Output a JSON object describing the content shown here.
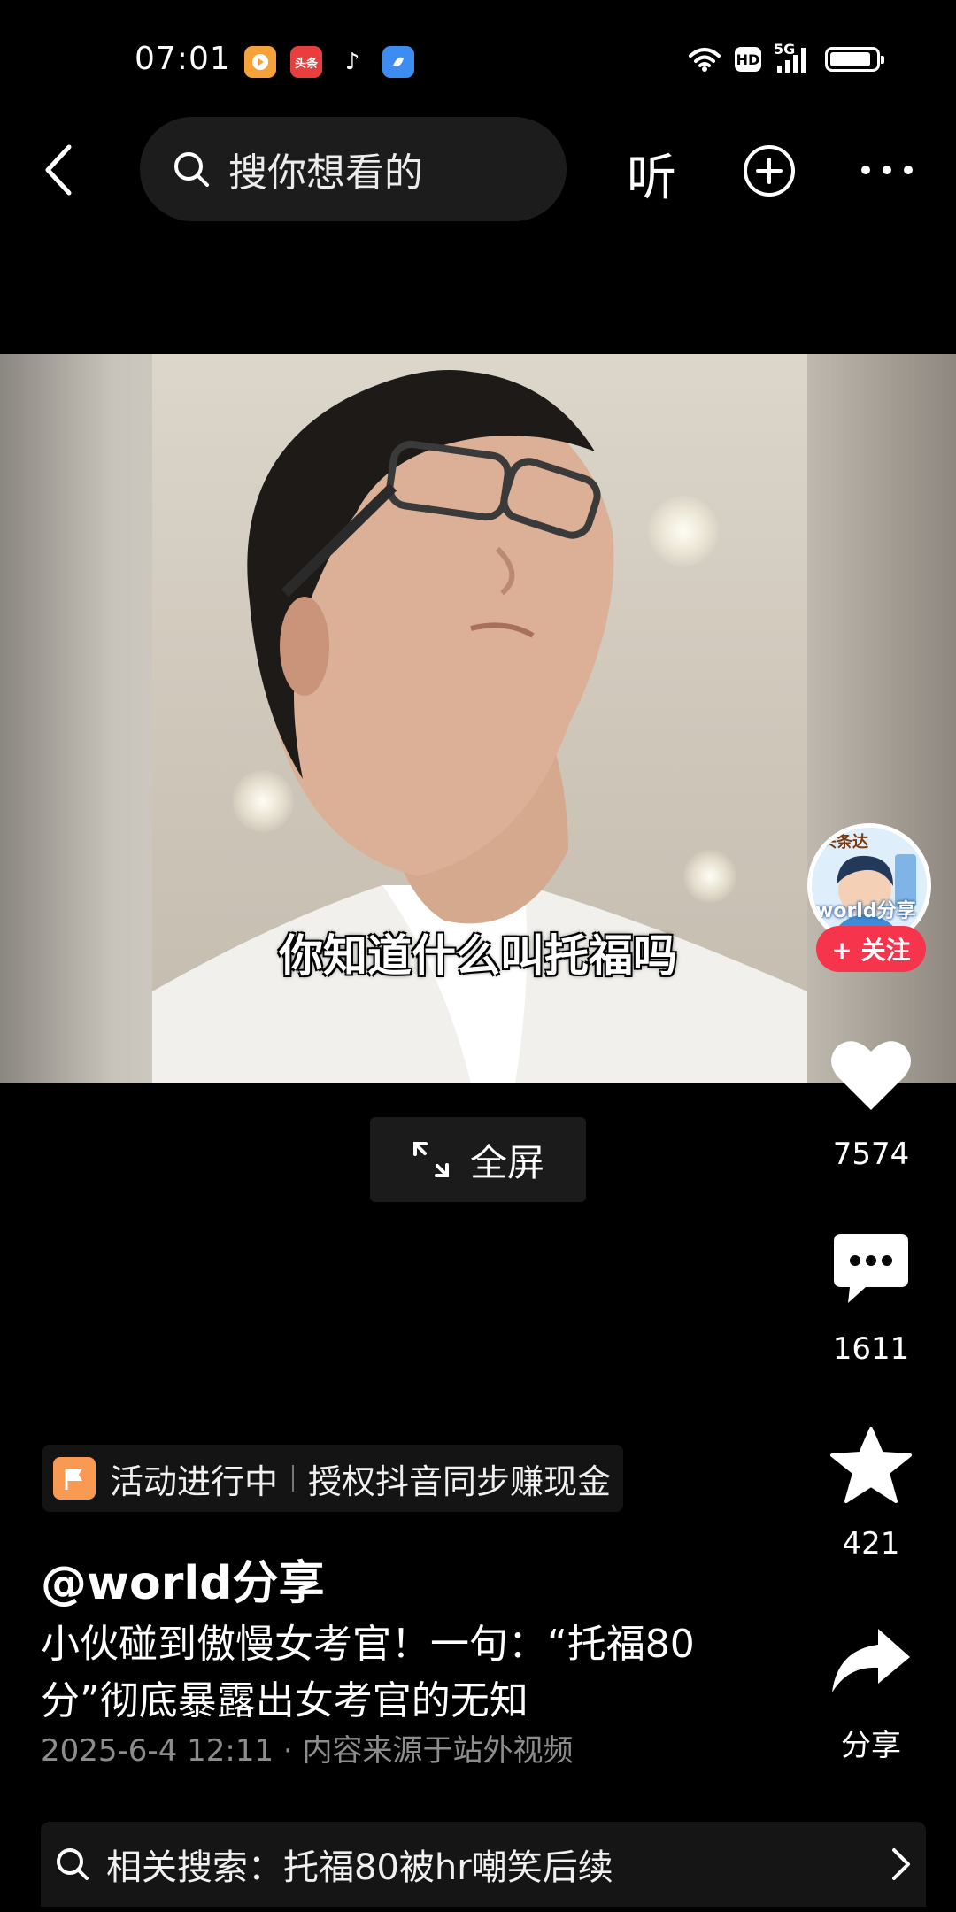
{
  "status_bar": {
    "time": "07:01",
    "app_icons": [
      {
        "name": "video-app-icon",
        "label": "",
        "color": "#f7a13a"
      },
      {
        "name": "toutiao-app-icon",
        "label": "头条",
        "color": "#e83e3e"
      },
      {
        "name": "douyin-app-icon",
        "label": "♪",
        "color": "#000000"
      },
      {
        "name": "blue-app-icon",
        "label": "",
        "color": "#3d8cf0"
      }
    ],
    "hd": "HD",
    "network": "5G",
    "battery_level": 0.9
  },
  "nav": {
    "search_placeholder": "搜你想看的",
    "listen_label": "听"
  },
  "video": {
    "subtitle": "你知道什么叫托福吗",
    "fullscreen_label": "全屏"
  },
  "rail": {
    "avatar_text_top": "头条达",
    "avatar_text": "world分享",
    "follow_label": "+ 关注",
    "like_count": "7574",
    "comment_count": "1611",
    "favorite_count": "421",
    "share_label": "分享"
  },
  "info": {
    "activity_status": "活动进行中",
    "activity_text": "授权抖音同步赚现金",
    "author": "@world分享",
    "description_line1": "小伙碰到傲慢女考官！一句：“托福80",
    "description_line2": "分”彻底暴露出女考官的无知",
    "meta": "2025-6-4 12:11 · 内容来源于站外视频"
  },
  "related": {
    "text": "相关搜索：托福80被hr嘲笑后续"
  },
  "colors": {
    "accent_red": "#f6344c",
    "background": "#000000"
  }
}
